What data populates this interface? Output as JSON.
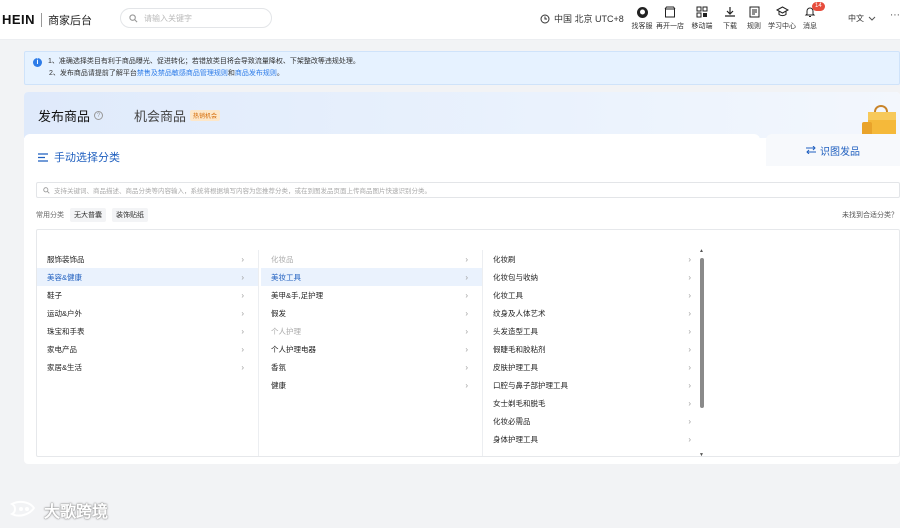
{
  "header": {
    "logo": "HEIN",
    "portal": "商家后台",
    "search_placeholder": "请输入关键字",
    "timezone": "中国 北京 UTC+8",
    "nav": [
      {
        "label": "找客服",
        "icon": "customer-service-icon"
      },
      {
        "label": "再开一店",
        "icon": "store-icon"
      },
      {
        "label": "移动端",
        "icon": "mobile-icon"
      },
      {
        "label": "下载",
        "icon": "download-icon"
      },
      {
        "label": "规则",
        "icon": "rules-icon"
      },
      {
        "label": "学习中心",
        "icon": "learning-center-icon"
      },
      {
        "label": "消息",
        "icon": "bell-icon",
        "badge": "14"
      }
    ],
    "language": "中文"
  },
  "notice": {
    "line1": "1、准确选择类目有利于商品曝光、促进转化；若错放类目将会导致流量降权、下架整改等违规处理。",
    "line2_prefix": "2、发布商品请提前了解平台",
    "line2_link1": "禁售及禁品敏感商品管理规则",
    "line2_mid": "和",
    "line2_link2": "商品发布规则",
    "line2_suffix": "。"
  },
  "tabs": {
    "publish": "发布商品",
    "opportunity": "机会商品",
    "opportunity_tag": "热销机会"
  },
  "manual": {
    "title": "手动选择分类",
    "photo_button": "识图发品",
    "search_placeholder": "支持关键词、商品描述、商品分类等内容输入，系统将根据填写内容为您推荐分类，或在到图发品页面上传商品图片快速识别分类。",
    "common_label": "常用分类",
    "common_chips": [
      "无大普囊",
      "装饰贴纸"
    ],
    "not_found": "未找到合适分类？"
  },
  "columns": {
    "level1": [
      {
        "label": "服饰装饰品",
        "state": ""
      },
      {
        "label": "美容&健康",
        "state": "sel"
      },
      {
        "label": "鞋子",
        "state": ""
      },
      {
        "label": "运动&户外",
        "state": ""
      },
      {
        "label": "珠宝和手表",
        "state": ""
      },
      {
        "label": "家电产品",
        "state": ""
      },
      {
        "label": "家居&生活",
        "state": ""
      }
    ],
    "level2": [
      {
        "label": "化妆品",
        "state": "dis"
      },
      {
        "label": "美妆工具",
        "state": "sel"
      },
      {
        "label": "美甲&手,足护理",
        "state": ""
      },
      {
        "label": "假发",
        "state": ""
      },
      {
        "label": "个人护理",
        "state": "dis"
      },
      {
        "label": "个人护理电器",
        "state": ""
      },
      {
        "label": "香氛",
        "state": ""
      },
      {
        "label": "健康",
        "state": ""
      }
    ],
    "level3": [
      {
        "label": "化妆刷",
        "state": ""
      },
      {
        "label": "化妆包与收纳",
        "state": ""
      },
      {
        "label": "化妆工具",
        "state": ""
      },
      {
        "label": "纹身及人体艺术",
        "state": ""
      },
      {
        "label": "头发造型工具",
        "state": ""
      },
      {
        "label": "假睫毛和胶粘剂",
        "state": ""
      },
      {
        "label": "皮肤护理工具",
        "state": ""
      },
      {
        "label": "口腔与鼻子部护理工具",
        "state": ""
      },
      {
        "label": "女士剃毛和脱毛",
        "state": ""
      },
      {
        "label": "化妆必需品",
        "state": ""
      },
      {
        "label": "身体护理工具",
        "state": ""
      }
    ]
  },
  "watermark": "大歌跨境",
  "colors": {
    "accent": "#1f5fbf",
    "notice_bg": "#e6f2ff",
    "badge": "#e74c3c"
  }
}
